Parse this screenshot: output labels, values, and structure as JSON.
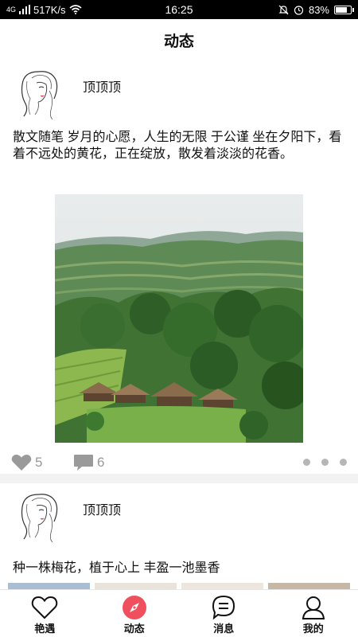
{
  "status_bar": {
    "network": "4G",
    "speed": "517K/s",
    "time": "16:25",
    "battery": "83%",
    "battery_level": 0.83
  },
  "header": {
    "title": "动态"
  },
  "posts": [
    {
      "author": "顶顶顶",
      "text": " 散文随笔 岁月的心愿，人生的无限 于公谨 坐在夕阳下，看着不远处的黄花，正在绽放，散发着淡淡的花香。",
      "likes": "5",
      "comments": "6"
    },
    {
      "author": "顶顶顶",
      "text": "种一株梅花，植于心上 丰盈一池墨香"
    }
  ],
  "tabs": [
    {
      "label": "艳遇",
      "icon": "heart-icon"
    },
    {
      "label": "动态",
      "icon": "compass-icon",
      "active": true
    },
    {
      "label": "消息",
      "icon": "message-icon"
    },
    {
      "label": "我的",
      "icon": "profile-icon"
    }
  ],
  "colors": {
    "accent": "#f0505e",
    "icon_gray": "#999999",
    "divider": "#f2f2f2"
  }
}
